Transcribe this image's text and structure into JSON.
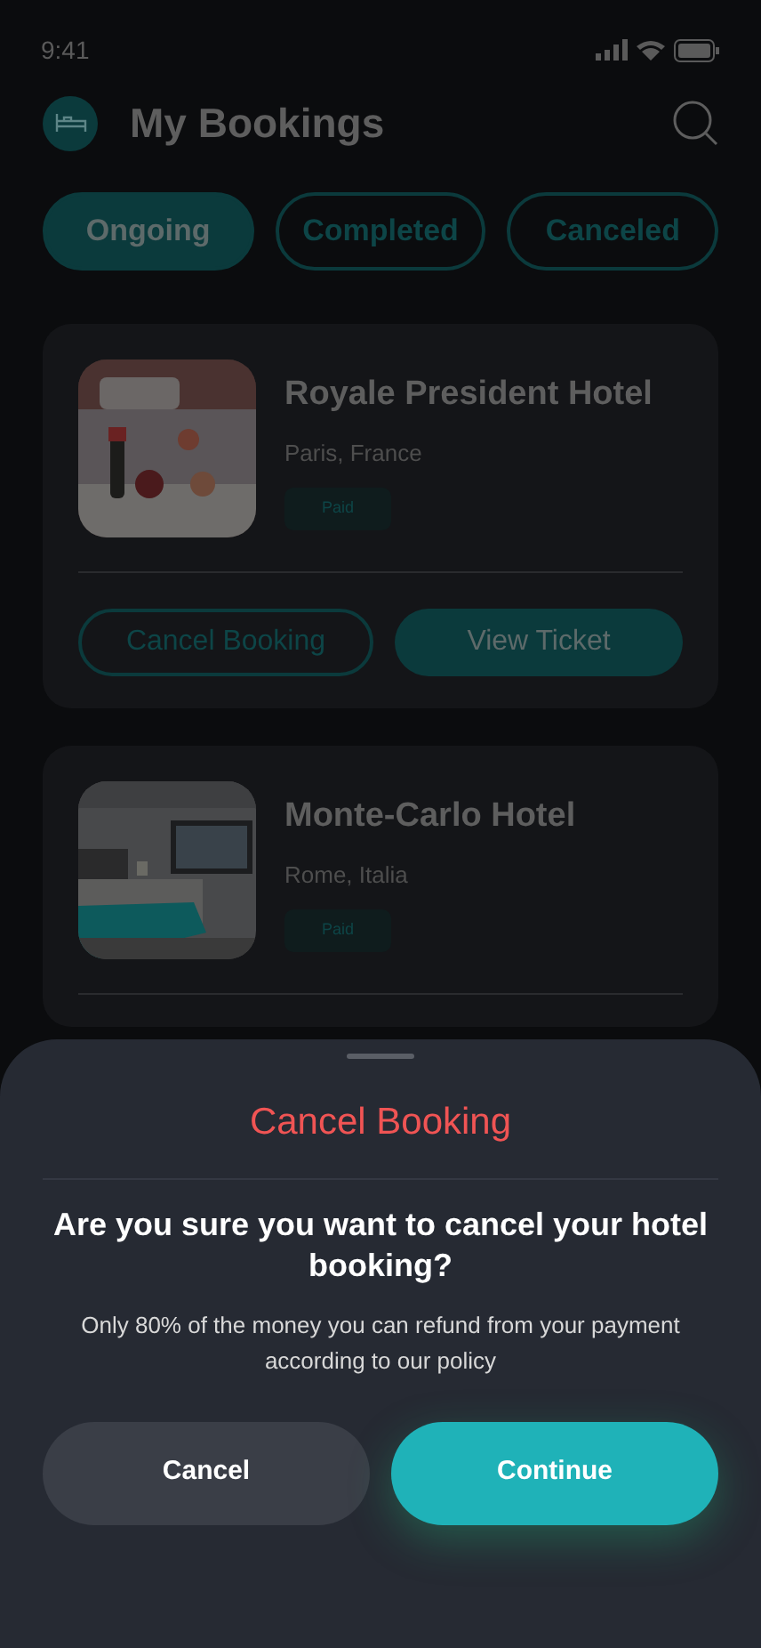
{
  "status_bar": {
    "time": "9:41"
  },
  "header": {
    "title": "My Bookings"
  },
  "tabs": [
    {
      "label": "Ongoing",
      "selected": true
    },
    {
      "label": "Completed",
      "selected": false
    },
    {
      "label": "Canceled",
      "selected": false
    }
  ],
  "bookings": [
    {
      "name": "Royale President Hotel",
      "location": "Paris, France",
      "status": "Paid",
      "buttons": [
        {
          "label": "Cancel Booking",
          "kind": "outline"
        },
        {
          "label": "View Ticket",
          "kind": "filled"
        }
      ]
    },
    {
      "name": "Monte-Carlo Hotel",
      "location": "Rome, Italia",
      "status": "Paid"
    }
  ],
  "sheet": {
    "title": "Cancel Booking",
    "question": "Are you sure you want to cancel your hotel booking?",
    "note": "Only 80% of the money you can refund from your payment according to our policy",
    "buttons": [
      {
        "label": "Cancel",
        "kind": "secondary"
      },
      {
        "label": "Continue",
        "kind": "primary"
      }
    ]
  }
}
